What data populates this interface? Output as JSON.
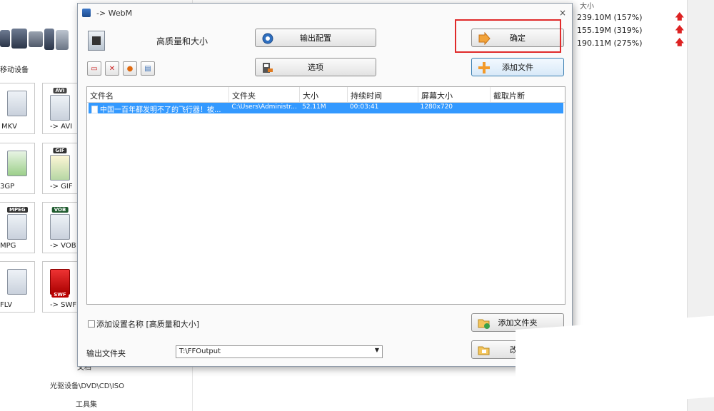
{
  "background": {
    "left_panel": {
      "device_label": "移动设备",
      "tiles": [
        {
          "badge": "",
          "label": "MKV"
        },
        {
          "badge": "AVI",
          "label": "-> AVI"
        },
        {
          "badge": "",
          "label": "3GP"
        },
        {
          "badge": "GIF",
          "label": "-> GIF"
        },
        {
          "badge": "MPEG",
          "label": "MPG"
        },
        {
          "badge": "VOB",
          "label": "-> VOB"
        },
        {
          "badge": "",
          "label": "FLV"
        },
        {
          "badge": "SWF",
          "label": "-> SWF"
        }
      ],
      "bottom_items": [
        "文档",
        "光驱设备\\DVD\\CD\\ISO",
        "工具集"
      ]
    },
    "right_panel": {
      "size_header": "大小",
      "rows": [
        {
          "size": "239.10M",
          "ratio": "(157%)"
        },
        {
          "size": "155.19M",
          "ratio": "(319%)"
        },
        {
          "size": "190.11M",
          "ratio": "(275%)"
        }
      ],
      "up_icon": "arrow-up-icon"
    }
  },
  "dialog": {
    "title": "-> WebM",
    "close_glyph": "×",
    "preset_label": "高质量和大小",
    "buttons": {
      "output_config": "输出配置",
      "options": "选项",
      "ok": "确定",
      "add_file": "添加文件",
      "add_folder": "添加文件夹",
      "change": "改变"
    },
    "toolbar_icons": [
      "remove-icon",
      "clear-icon",
      "play-icon",
      "media-info-icon"
    ],
    "columns": [
      "文件名",
      "文件夹",
      "大小",
      "持续时间",
      "屏幕大小",
      "截取片断"
    ],
    "files": [
      {
        "name": "中国一百年都发明不了的飞行器！被...",
        "folder": "C:\\Users\\Administr...",
        "size": "52.11M",
        "duration": "00:03:41",
        "screen": "1280x720",
        "clip": ""
      }
    ],
    "add_setting_label": "添加设置名称 [高质量和大小]",
    "output_folder_label": "输出文件夹",
    "output_folder_value": "T:\\FFOutput",
    "colors": {
      "selection": "#3399ff",
      "highlight_box": "#e02a2a"
    }
  }
}
